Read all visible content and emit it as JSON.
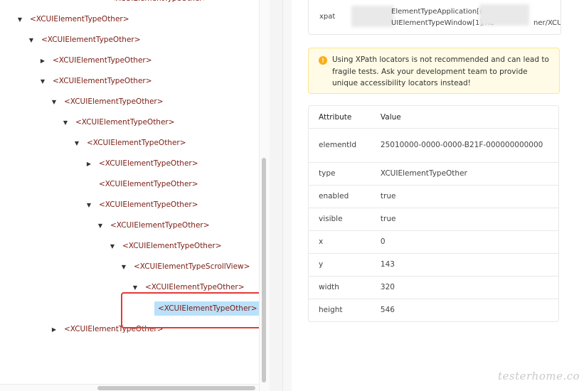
{
  "tree": {
    "nodes": [
      {
        "label": "<XCUIElementTypeOther>",
        "state": "expanded"
      },
      {
        "label": "<XCUIElementTypeOther>",
        "state": "expanded"
      },
      {
        "label": "<XCUIElementTypeOther>",
        "state": "collapsed"
      },
      {
        "label": "<XCUIElementTypeOther>",
        "state": "expanded"
      },
      {
        "label": "<XCUIElementTypeOther>",
        "state": "expanded"
      },
      {
        "label": "<XCUIElementTypeOther>",
        "state": "expanded"
      },
      {
        "label": "<XCUIElementTypeOther>",
        "state": "expanded"
      },
      {
        "label": "<XCUIElementTypeOther>",
        "state": "collapsed"
      },
      {
        "label": "<XCUIElementTypeOther>",
        "state": "leaf"
      },
      {
        "label": "<XCUIElementTypeOther>",
        "state": "expanded"
      },
      {
        "label": "<XCUIElementTypeOther>",
        "state": "expanded"
      },
      {
        "label": "<XCUIElementTypeOther>",
        "state": "expanded"
      },
      {
        "label": "<XCUIElementTypeScrollView>",
        "state": "expanded"
      },
      {
        "label": "<XCUIElementTypeOther>",
        "state": "expanded"
      },
      {
        "label": "<XCUIElementTypeOther>",
        "state": "selected"
      },
      {
        "label": "<XCUIElementTypeOther>",
        "state": "collapsed"
      }
    ]
  },
  "details": {
    "xpath": {
      "label": "xpat",
      "line1": "ElementTypeApplication[@n",
      "line2": "UIElementTypeWindow[1]/XC",
      "line2_tail": "ner/XCU"
    },
    "warning": {
      "icon": "warning-icon",
      "text": "Using XPath locators is not recommended and can lead to fragile tests. Ask your development team to provide unique accessibility locators instead!"
    },
    "table": {
      "headers": [
        "Attribute",
        "Value"
      ],
      "rows": [
        {
          "attr": "elementId",
          "value": "25010000-0000-0000-B21F-000000000000"
        },
        {
          "attr": "type",
          "value": "XCUIElementTypeOther"
        },
        {
          "attr": "enabled",
          "value": "true"
        },
        {
          "attr": "visible",
          "value": "true"
        },
        {
          "attr": "x",
          "value": "0"
        },
        {
          "attr": "y",
          "value": "143"
        },
        {
          "attr": "width",
          "value": "320"
        },
        {
          "attr": "height",
          "value": "546"
        }
      ]
    }
  },
  "watermark": "testerhome.com",
  "colors": {
    "tree_text": "#7a1b12",
    "selection": "#b9e1fa",
    "highlight_box": "#e53935",
    "warning_bg": "#fffbe6",
    "warning_border": "#ffe58f",
    "warning_icon": "#faad14"
  }
}
